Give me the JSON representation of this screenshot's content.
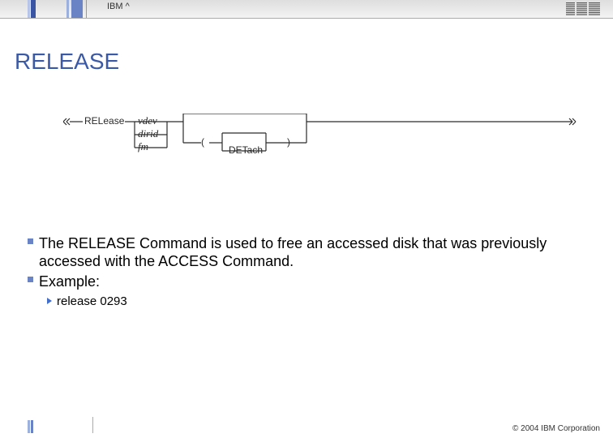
{
  "header": {
    "product": "IBM ^",
    "logo_alt": "IBM"
  },
  "title": "RELEASE",
  "diagram": {
    "command": "RELease",
    "options": [
      "vdev",
      "dirid",
      "fm"
    ],
    "paren_open": "(",
    "modifier": "DETach",
    "paren_close": ")"
  },
  "bullets": [
    {
      "text": "The RELEASE Command is used to free an accessed disk that was previously accessed with the ACCESS Command."
    },
    {
      "text": "Example:"
    }
  ],
  "sub_bullets": [
    {
      "text": "release 0293"
    }
  ],
  "footer": {
    "copyright": "© 2004 IBM Corporation"
  }
}
